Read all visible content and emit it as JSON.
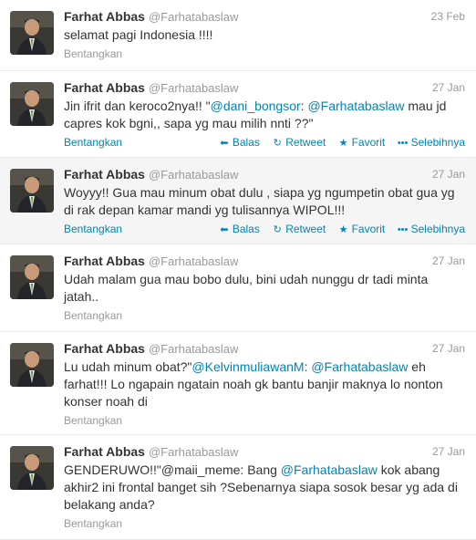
{
  "actions": {
    "reply": "Balas",
    "retweet": "Retweet",
    "favorite": "Favorit",
    "more": "Selebihnya",
    "expand": "Bentangkan"
  },
  "colors": {
    "link": "#0084b4",
    "muted": "#999999",
    "hover_bg": "#f5f5f5"
  },
  "tweets": [
    {
      "fullname": "Farhat Abbas",
      "username": "@Farhatabaslaw",
      "time": "23 Feb",
      "text": "selamat pagi Indonesia !!!!"
    },
    {
      "fullname": "Farhat Abbas",
      "username": "@Farhatabaslaw",
      "time": "27 Jan",
      "text_a": "Jin ifrit dan keroco2nya!! \"",
      "mention1": "@dani_bongsor",
      "text_b": ": ",
      "mention2": "@Farhatabaslaw",
      "text_c": " mau jd capres kok bgni,, sapa yg mau milih nnti ??\""
    },
    {
      "fullname": "Farhat Abbas",
      "username": "@Farhatabaslaw",
      "time": "27 Jan",
      "text": "Woyyy!! Gua mau minum obat dulu , siapa yg ngumpetin obat gua yg di rak depan kamar mandi yg tulisannya WIPOL!!!"
    },
    {
      "fullname": "Farhat Abbas",
      "username": "@Farhatabaslaw",
      "time": "27 Jan",
      "text": "Udah malam gua mau bobo dulu, bini udah nunggu dr tadi minta jatah.."
    },
    {
      "fullname": "Farhat Abbas",
      "username": "@Farhatabaslaw",
      "time": "27 Jan",
      "text_a": "Lu udah minum obat?\"",
      "mention1": "@KelvinmuliawanM",
      "text_b": ": ",
      "mention2": "@Farhatabaslaw",
      "text_c": " eh farhat!!! Lo ngapain ngatain noah gk bantu banjir maknya lo nonton konser noah di"
    },
    {
      "fullname": "Farhat Abbas",
      "username": "@Farhatabaslaw",
      "time": "27 Jan",
      "text_a": "GENDERUWO!!\"@maii_meme: Bang ",
      "mention1": "@Farhatabaslaw",
      "text_b": " kok abang akhir2 ini frontal banget sih ?Sebenarnya siapa sosok besar yg ada di belakang anda?"
    }
  ]
}
